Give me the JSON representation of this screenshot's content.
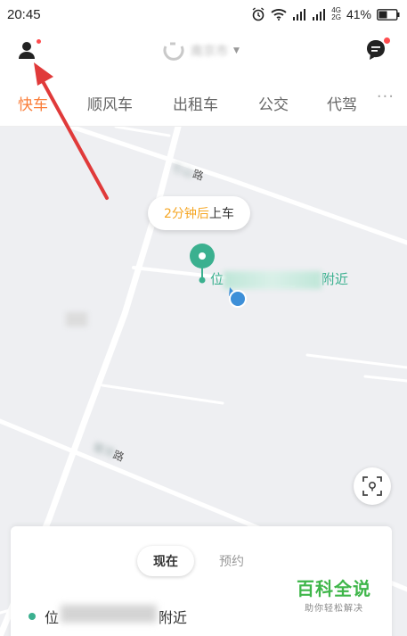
{
  "status_bar": {
    "time": "20:45",
    "network_top": "4G",
    "network_bottom": "2G",
    "battery": "41%"
  },
  "header": {
    "city": "南京市",
    "icons": [
      "person-icon",
      "didi-logo-icon",
      "message-icon"
    ]
  },
  "tabs": [
    {
      "label": "快车",
      "active": true
    },
    {
      "label": "顺风车",
      "active": false
    },
    {
      "label": "出租车",
      "active": false
    },
    {
      "label": "公交",
      "active": false
    },
    {
      "label": "代驾",
      "active": false
    }
  ],
  "tabs_more": "···",
  "map": {
    "road_labels": [
      "路",
      "路"
    ],
    "eta_highlight": "2分钟后",
    "eta_rest": "上车",
    "pickup_label_start": "位",
    "pickup_label_end": "附近"
  },
  "card": {
    "now_label": "现在",
    "later_label": "预约",
    "pickup_start": "位",
    "pickup_end": "附近"
  },
  "watermark": {
    "main": "百科全说",
    "sub": "助你轻松解决"
  },
  "colors": {
    "accent": "#fa7e3a",
    "green": "#3bb08f",
    "annotation_red": "#e03a3a",
    "eta_orange": "#f5a623"
  }
}
